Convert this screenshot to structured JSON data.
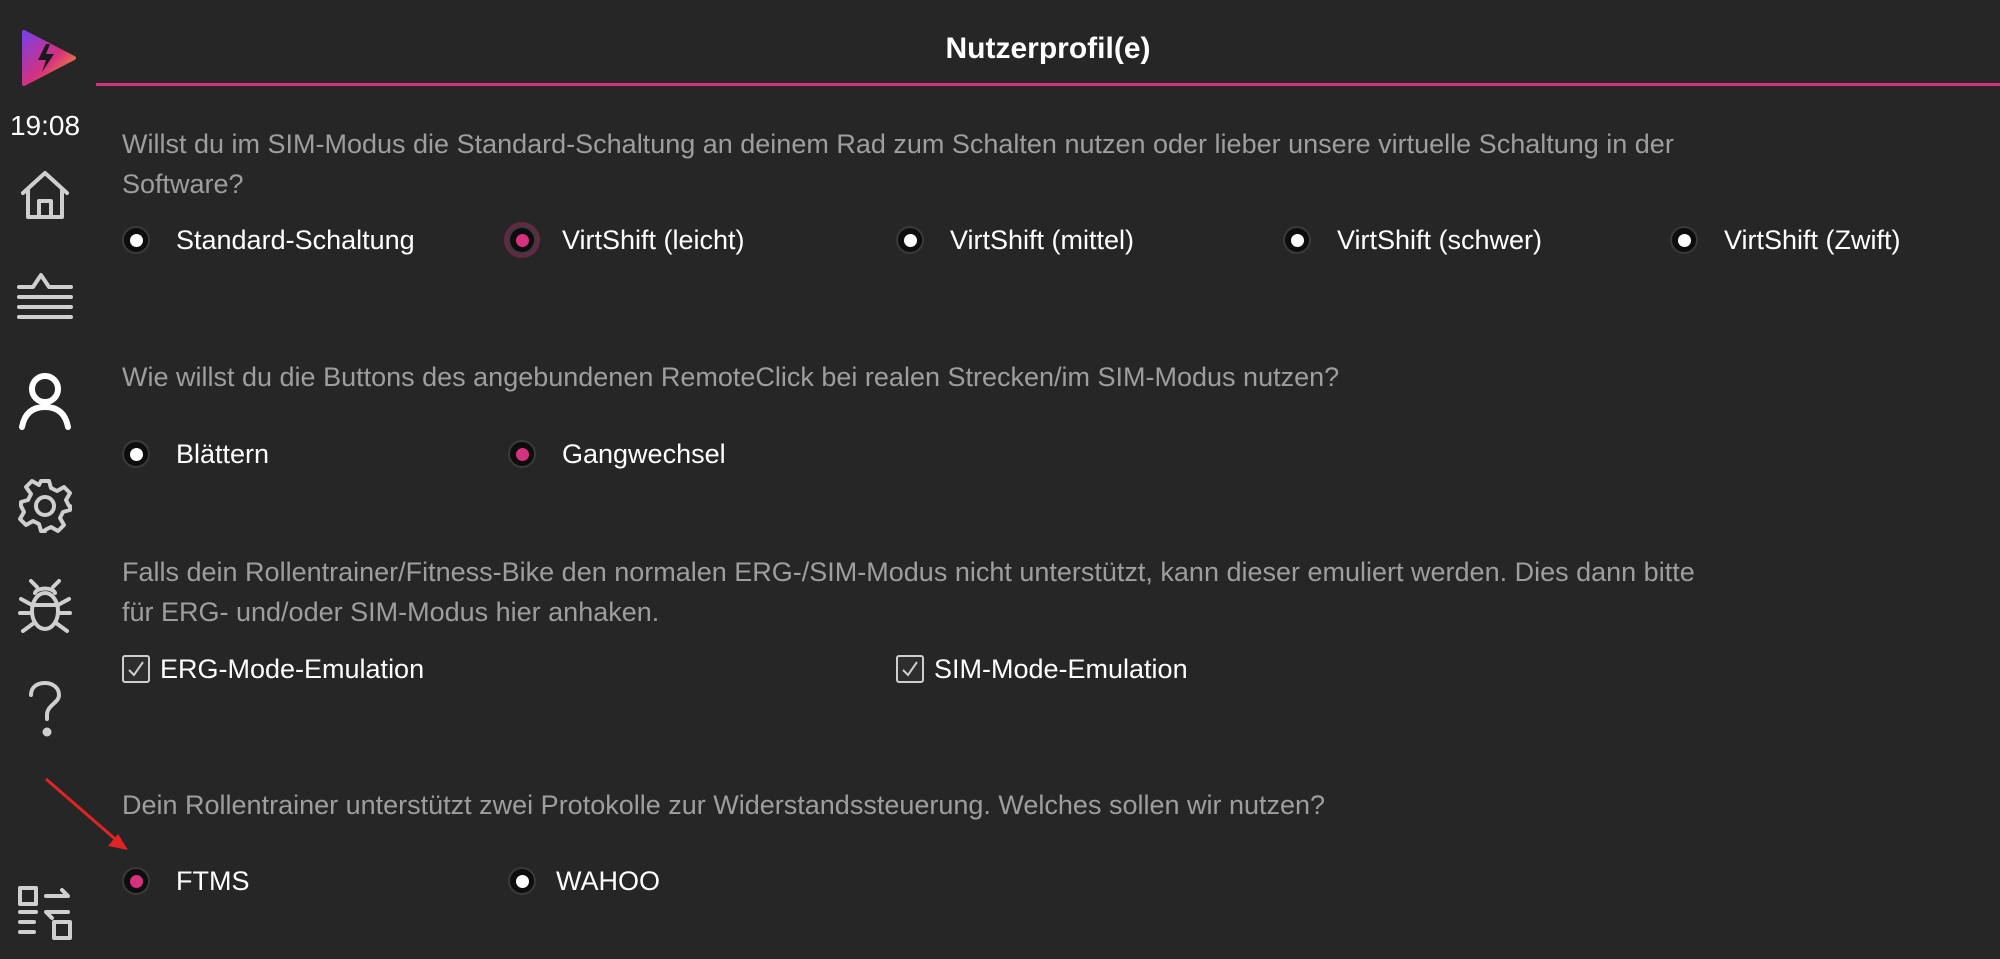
{
  "sidebar": {
    "time": "19:08",
    "items": [
      {
        "name": "home-icon"
      },
      {
        "name": "workouts-list-icon"
      },
      {
        "name": "user-profile-icon",
        "active": true
      },
      {
        "name": "gear-icon"
      },
      {
        "name": "bug-icon"
      },
      {
        "name": "help-icon"
      },
      {
        "name": "swap-icon"
      }
    ]
  },
  "header": {
    "title": "Nutzerprofil(e)"
  },
  "colors": {
    "accent": "#d6317e",
    "background": "#262626",
    "question_text": "#9e9e9e"
  },
  "sections": {
    "shifting": {
      "question": "Willst du im SIM-Modus die Standard-Schaltung an deinem Rad zum Schalten nutzen oder lieber unsere virtuelle Schaltung in der Software?",
      "options": [
        {
          "label": "Standard-Schaltung",
          "selected": false
        },
        {
          "label": "VirtShift (leicht)",
          "selected": true
        },
        {
          "label": "VirtShift (mittel)",
          "selected": false
        },
        {
          "label": "VirtShift (schwer)",
          "selected": false
        },
        {
          "label": "VirtShift (Zwift)",
          "selected": false
        }
      ]
    },
    "remoteclick": {
      "question": "Wie willst du die Buttons des angebundenen RemoteClick bei realen Strecken/im SIM-Modus nutzen?",
      "options": [
        {
          "label": "Blättern",
          "selected": false
        },
        {
          "label": "Gangwechsel",
          "selected": true
        }
      ]
    },
    "emulation": {
      "question": "Falls dein Rollentrainer/Fitness-Bike den normalen ERG-/SIM-Modus nicht unterstützt, kann dieser emuliert werden. Dies dann bitte für ERG- und/oder SIM-Modus hier anhaken.",
      "options": [
        {
          "label": "ERG-Mode-Emulation",
          "checked": true
        },
        {
          "label": "SIM-Mode-Emulation",
          "checked": true
        }
      ]
    },
    "protocol": {
      "question": "Dein Rollentrainer unterstützt zwei Protokolle zur Widerstandssteuerung. Welches sollen wir nutzen?",
      "options": [
        {
          "label": "FTMS",
          "selected": true
        },
        {
          "label": "WAHOO",
          "selected": false
        }
      ]
    }
  }
}
